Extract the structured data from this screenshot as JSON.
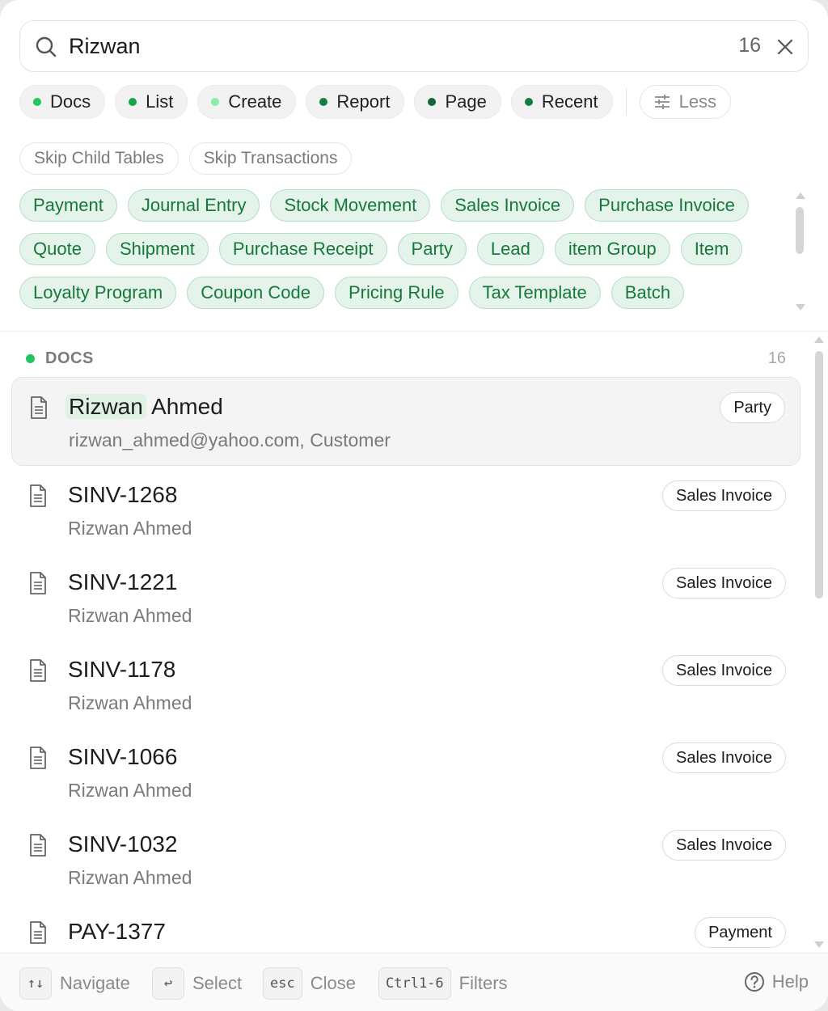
{
  "search": {
    "value": "Rizwan",
    "count": "16"
  },
  "filters": [
    {
      "label": "Docs",
      "color": "#22c55e"
    },
    {
      "label": "List",
      "color": "#16a34a"
    },
    {
      "label": "Create",
      "color": "#86efac"
    },
    {
      "label": "Report",
      "color": "#15803d"
    },
    {
      "label": "Page",
      "color": "#166534"
    },
    {
      "label": "Recent",
      "color": "#15803d"
    }
  ],
  "less_label": "Less",
  "skip_options": [
    "Skip Child Tables",
    "Skip Transactions"
  ],
  "doctype_tags": [
    [
      "Payment",
      "Journal Entry",
      "Stock Movement",
      "Sales Invoice",
      "Purchase Invoice"
    ],
    [
      "Quote",
      "Shipment",
      "Purchase Receipt",
      "Party",
      "Lead",
      "item Group",
      "Item"
    ],
    [
      "Loyalty Program",
      "Coupon Code",
      "Pricing Rule",
      "Tax Template",
      "Batch"
    ]
  ],
  "section": {
    "title": "DOCS",
    "count": "16"
  },
  "results": [
    {
      "title_highlight": "Rizwan",
      "title_rest": " Ahmed",
      "subtitle": "rizwan_ahmed@yahoo.com, Customer",
      "badge": "Party",
      "selected": true
    },
    {
      "title_highlight": "",
      "title_rest": "SINV-1268",
      "subtitle": "Rizwan Ahmed",
      "badge": "Sales Invoice",
      "selected": false
    },
    {
      "title_highlight": "",
      "title_rest": "SINV-1221",
      "subtitle": "Rizwan Ahmed",
      "badge": "Sales Invoice",
      "selected": false
    },
    {
      "title_highlight": "",
      "title_rest": "SINV-1178",
      "subtitle": "Rizwan Ahmed",
      "badge": "Sales Invoice",
      "selected": false
    },
    {
      "title_highlight": "",
      "title_rest": "SINV-1066",
      "subtitle": "Rizwan Ahmed",
      "badge": "Sales Invoice",
      "selected": false
    },
    {
      "title_highlight": "",
      "title_rest": "SINV-1032",
      "subtitle": "Rizwan Ahmed",
      "badge": "Sales Invoice",
      "selected": false
    },
    {
      "title_highlight": "",
      "title_rest": "PAY-1377",
      "subtitle": "",
      "badge": "Payment",
      "selected": false
    }
  ],
  "footer": {
    "navigate_key": "↑↓",
    "navigate_label": "Navigate",
    "select_key": "↩",
    "select_label": "Select",
    "close_key": "esc",
    "close_label": "Close",
    "filters_key": "Ctrl1-6",
    "filters_label": "Filters",
    "help_label": "Help"
  },
  "icons": {
    "search": "search-icon",
    "close": "close-icon",
    "less": "sliders-icon",
    "document": "document-icon",
    "help": "help-circle-icon"
  }
}
